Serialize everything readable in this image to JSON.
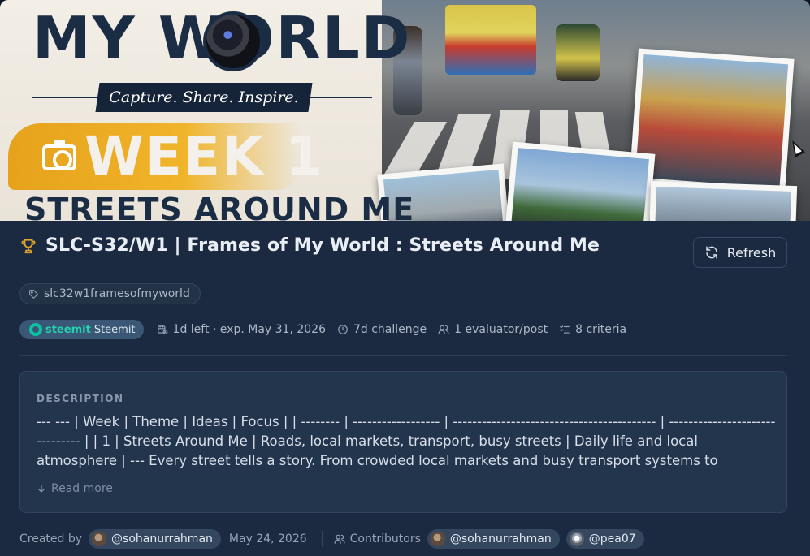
{
  "banner": {
    "title_line1": "MY WORLD",
    "tagline": "Capture. Share. Inspire.",
    "week": "WEEK 1",
    "subtitle": "STREETS AROUND ME"
  },
  "challenge": {
    "title": "SLC-S32/W1 | Frames of My World : Streets Around Me",
    "refresh_label": "Refresh",
    "tag": "slc32w1framesofmyworld",
    "platform_brand": "steemit",
    "platform_label": "Steemit",
    "deadline": "1d left · exp. May 31, 2026",
    "duration": "7d challenge",
    "evaluators": "1 evaluator/post",
    "criteria": "8 criteria"
  },
  "description": {
    "heading": "DESCRIPTION",
    "text": "--- --- | Week | Theme | Ideas | Focus | | -------- | ------------------ | ------------------------------------------ | ------------------------------- | | 1 | Streets Around Me | Roads, local markets, transport, busy streets | Daily life and local atmosphere | --- Every street tells a story. From crowded local markets and busy transport systems to peaceful…",
    "read_more": "Read more"
  },
  "footer": {
    "created_by_label": "Created by",
    "creator": "@sohanurrahman",
    "created_date": "May 24, 2026",
    "contributors_label": "Contributors",
    "contributors": [
      "@sohanurrahman",
      "@pea07"
    ]
  },
  "colors": {
    "accent_gold": "#e2a32a",
    "steemit_green": "#22d3b0",
    "panel_bg": "#1b2a40"
  }
}
